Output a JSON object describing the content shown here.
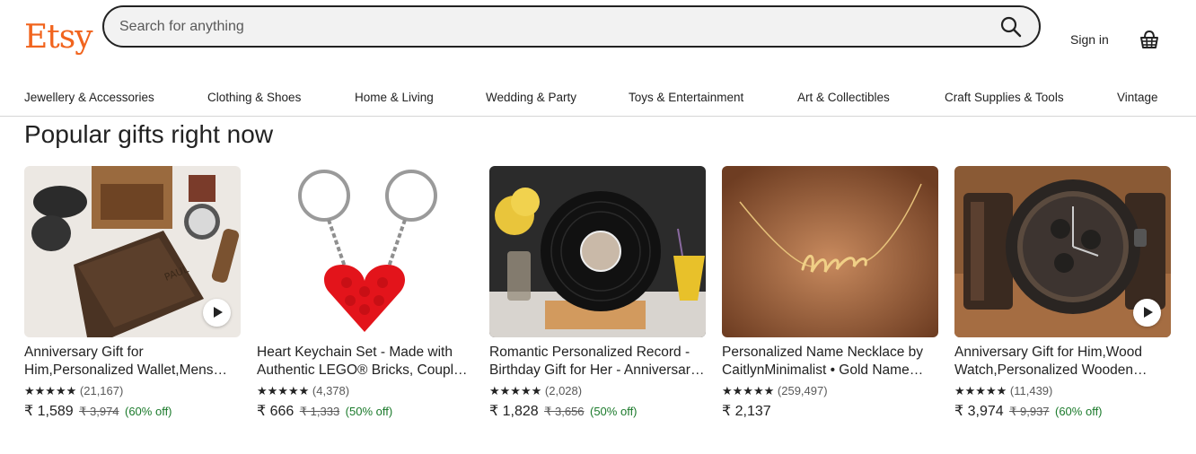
{
  "brand": {
    "logo_text": "Etsy",
    "accent": "#F1641E"
  },
  "search": {
    "placeholder": "Search for anything",
    "icon": "search-icon"
  },
  "header": {
    "signin_label": "Sign in",
    "cart_icon": "basket-icon"
  },
  "nav": {
    "items": [
      "Jewellery & Accessories",
      "Clothing & Shoes",
      "Home & Living",
      "Wedding & Party",
      "Toys & Entertainment",
      "Art & Collectibles",
      "Craft Supplies & Tools",
      "Vintage"
    ]
  },
  "section": {
    "title": "Popular gifts right now"
  },
  "products": [
    {
      "title": "Anniversary Gift for Him,Personalized Wallet,Mens Wallet,Leather Wallet",
      "stars": "★★★★★",
      "reviews": "(21,167)",
      "price": "₹ 1,589",
      "original": "₹ 3,974",
      "discount": "(60% off)",
      "has_video": true
    },
    {
      "title": "Heart Keychain Set - Made with Authentic LEGO® Bricks, Couple Keychain",
      "stars": "★★★★★",
      "reviews": "(4,378)",
      "price": "₹ 666",
      "original": "₹ 1,333",
      "discount": "(50% off)",
      "has_video": false
    },
    {
      "title": "Romantic Personalized Record - Birthday Gift for Her - Anniversary Gift",
      "stars": "★★★★★",
      "reviews": "(2,028)",
      "price": "₹ 1,828",
      "original": "₹ 3,656",
      "discount": "(50% off)",
      "has_video": false
    },
    {
      "title": "Personalized Name Necklace by CaitlynMinimalist • Gold Name Necklace",
      "stars": "★★★★★",
      "reviews": "(259,497)",
      "price": "₹ 2,137",
      "original": "",
      "discount": "",
      "has_video": false
    },
    {
      "title": "Anniversary Gift for Him,Wood Watch,Personalized Wooden Watch",
      "stars": "★★★★★",
      "reviews": "(11,439)",
      "price": "₹ 3,974",
      "original": "₹ 9,937",
      "discount": "(60% off)",
      "has_video": true
    }
  ],
  "colors": {
    "text": "#222222",
    "muted": "#595959",
    "discount": "#1b7a2b",
    "divider": "#d5d5d5"
  }
}
